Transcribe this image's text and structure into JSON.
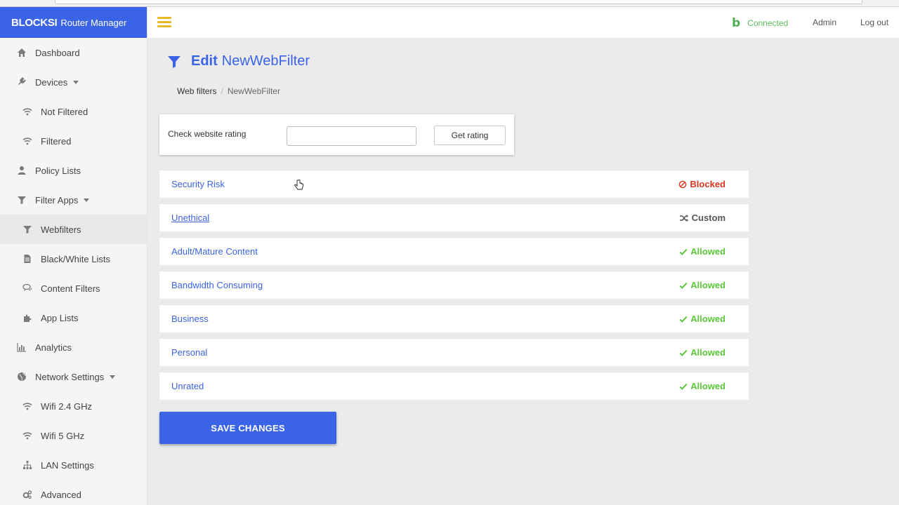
{
  "brand": {
    "name": "BLOCKSI",
    "product": "Router Manager"
  },
  "header": {
    "status": "Connected",
    "admin": "Admin",
    "logout": "Log out",
    "status_color": "#5cb85c"
  },
  "sidebar": {
    "items": [
      {
        "label": "Dashboard",
        "icon": "home-icon",
        "level": "top"
      },
      {
        "label": "Devices",
        "icon": "plug-icon",
        "level": "top",
        "caret": true
      },
      {
        "label": "Not Filtered",
        "icon": "wifi-icon",
        "level": "sub"
      },
      {
        "label": "Filtered",
        "icon": "wifi-icon",
        "level": "sub"
      },
      {
        "label": "Policy Lists",
        "icon": "user-icon",
        "level": "top"
      },
      {
        "label": "Filter Apps",
        "icon": "filter-icon",
        "level": "top",
        "caret": true
      },
      {
        "label": "Webfilters",
        "icon": "filter-icon",
        "level": "sub",
        "active": true
      },
      {
        "label": "Black/White Lists",
        "icon": "file-icon",
        "level": "sub"
      },
      {
        "label": "Content Filters",
        "icon": "comments-icon",
        "level": "sub"
      },
      {
        "label": "App Lists",
        "icon": "puzzle-icon",
        "level": "sub"
      },
      {
        "label": "Analytics",
        "icon": "bar-chart-icon",
        "level": "top"
      },
      {
        "label": "Network Settings",
        "icon": "globe-icon",
        "level": "top",
        "caret": true
      },
      {
        "label": "Wifi 2.4 GHz",
        "icon": "wifi-icon",
        "level": "sub"
      },
      {
        "label": "Wifi 5 GHz",
        "icon": "wifi-icon",
        "level": "sub"
      },
      {
        "label": "LAN Settings",
        "icon": "sitemap-icon",
        "level": "sub"
      },
      {
        "label": "Advanced",
        "icon": "cogs-icon",
        "level": "sub"
      }
    ]
  },
  "page": {
    "title_prefix": "Edit",
    "title_name": "NewWebFilter",
    "breadcrumb": {
      "parent": "Web filters",
      "current": "NewWebFilter"
    }
  },
  "rating": {
    "label": "Check website rating",
    "input_value": "",
    "input_placeholder": "",
    "button": "Get rating"
  },
  "categories": [
    {
      "name": "Security Risk",
      "status": "Blocked",
      "status_icon": "ban-icon",
      "color": "#d9361e",
      "underline": false
    },
    {
      "name": "Unethical",
      "status": "Custom",
      "status_icon": "random-icon",
      "color": "#555555",
      "underline": true
    },
    {
      "name": "Adult/Mature Content",
      "status": "Allowed",
      "status_icon": "check-icon",
      "color": "#5ac83a",
      "underline": false
    },
    {
      "name": "Bandwidth Consuming",
      "status": "Allowed",
      "status_icon": "check-icon",
      "color": "#5ac83a",
      "underline": false
    },
    {
      "name": "Business",
      "status": "Allowed",
      "status_icon": "check-icon",
      "color": "#5ac83a",
      "underline": false
    },
    {
      "name": "Personal",
      "status": "Allowed",
      "status_icon": "check-icon",
      "color": "#5ac83a",
      "underline": false
    },
    {
      "name": "Unrated",
      "status": "Allowed",
      "status_icon": "check-icon",
      "color": "#5ac83a",
      "underline": false
    }
  ],
  "actions": {
    "save": "SAVE CHANGES"
  },
  "colors": {
    "accent": "#3b63e6",
    "menu_icon": "#e8b825"
  }
}
